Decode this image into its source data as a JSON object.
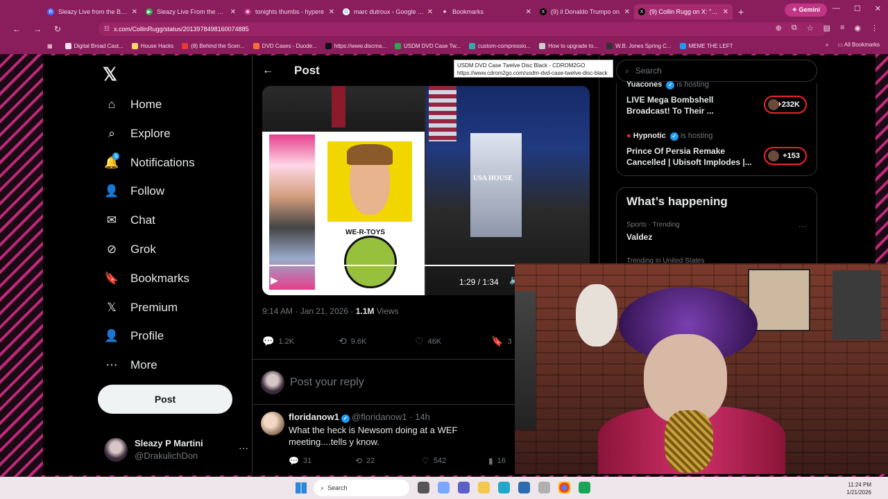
{
  "browser": {
    "tabs": [
      {
        "label": "Sleazy Live from the Bunk",
        "fav_color": "#4b6cff",
        "fav_glyph": "R"
      },
      {
        "label": "Sleazy Live From the Bunk",
        "fav_color": "#3aa655",
        "fav_glyph": "▶"
      },
      {
        "label": "tonights thumbs - hypere",
        "fav_color": "#c23485",
        "fav_glyph": "■"
      },
      {
        "label": "marc dutroux - Google Se",
        "fav_color": "#ffffff",
        "fav_glyph": "G"
      },
      {
        "label": "Bookmarks",
        "fav_color": "#8a1d5c",
        "fav_glyph": "★"
      },
      {
        "label": "(9) il Donaldo Trumpo on",
        "fav_color": "#000000",
        "fav_glyph": "X"
      },
      {
        "label": "(9) Collin Rugg on X: \"NEV",
        "fav_color": "#000000",
        "fav_glyph": "X"
      }
    ],
    "gemini_label": "Gemini",
    "url": "x.com/CollinRugg/status/2013978498160074885",
    "bookmarks": [
      "Digital Broad Cast...",
      "House Hacks",
      "(8) Behind the Scen...",
      "DVD Cases - Duode...",
      "https://www.discma...",
      "USDM DVD Case Tw...",
      "custom-compressio...",
      "How to upgrade to...",
      "W.B. Jones Spring C...",
      "MEME THE LEFT"
    ],
    "all_bookmarks": "All Bookmarks",
    "tooltip": {
      "title": "USDM DVD Case Twelve Disc Black - CDROM2GO",
      "url": "https://www.cdrom2go.com/usdm-dvd-case-twelve-disc-black"
    }
  },
  "nav": {
    "items": [
      {
        "label": "Home",
        "icon": "home-icon",
        "glyph": "⌂"
      },
      {
        "label": "Explore",
        "icon": "search-icon",
        "glyph": "⌕"
      },
      {
        "label": "Notifications",
        "icon": "bell-icon",
        "glyph": "🔔"
      },
      {
        "label": "Follow",
        "icon": "follow-icon",
        "glyph": "👤"
      },
      {
        "label": "Chat",
        "icon": "mail-icon",
        "glyph": "✉"
      },
      {
        "label": "Grok",
        "icon": "grok-icon",
        "glyph": "⊘"
      },
      {
        "label": "Bookmarks",
        "icon": "bookmark-icon",
        "glyph": "🔖"
      },
      {
        "label": "Premium",
        "icon": "x-premium-icon",
        "glyph": "𝕏"
      },
      {
        "label": "Profile",
        "icon": "profile-icon",
        "glyph": "👤"
      },
      {
        "label": "More",
        "icon": "more-circle-icon",
        "glyph": "⋯"
      }
    ],
    "notifications_badge": "9",
    "post_button": "Post",
    "profile": {
      "name": "Sleazy P Martini",
      "handle": "@DrakulichDon"
    }
  },
  "post": {
    "header_title": "Post",
    "video_time": "1:29 / 1:34",
    "video_progress": 0.947,
    "podium_text": "USA HOUSE",
    "toy_brand": "WE-R-TOYS",
    "meta_time": "9:14 AM · Jan 21, 2026 · ",
    "meta_views": "1.1M",
    "meta_views_label": " Views",
    "actions": {
      "replies": "1.2K",
      "reposts": "9.6K",
      "likes": "46K",
      "bookmarks": "3"
    },
    "reply_placeholder": "Post your reply"
  },
  "reply": {
    "name": "floridanow1",
    "handle": "@floridanow1 · 14h",
    "text": "What the heck is Newsom doing at a WEF meeting....tells y know.",
    "replies": "31",
    "reposts": "22",
    "likes": "542",
    "views": "16"
  },
  "right": {
    "search_placeholder": "Search",
    "spaces": [
      {
        "host": "Yuacones",
        "hosting": "is hosting",
        "title": "LIVE Mega Bombshell Broadcast! To Their ...",
        "count": "+232K"
      },
      {
        "host": "Hypnotic",
        "hosting": "is hosting",
        "title": "Prince Of Persia Remake Cancelled | Ubisoft Implodes |...",
        "count": "+153"
      }
    ],
    "happening_title": "What’s happening",
    "trends": [
      {
        "sub": "Sports · Trending",
        "name": "Valdez"
      },
      {
        "sub": "Trending in United States",
        "name": ""
      }
    ]
  },
  "taskbar": {
    "search": "Search",
    "time": "11:24 PM",
    "date": "1/21/2026"
  },
  "colors": {
    "chrome": "#8a1d5c",
    "accent": "#1d9bf0",
    "live": "#f4212e"
  }
}
